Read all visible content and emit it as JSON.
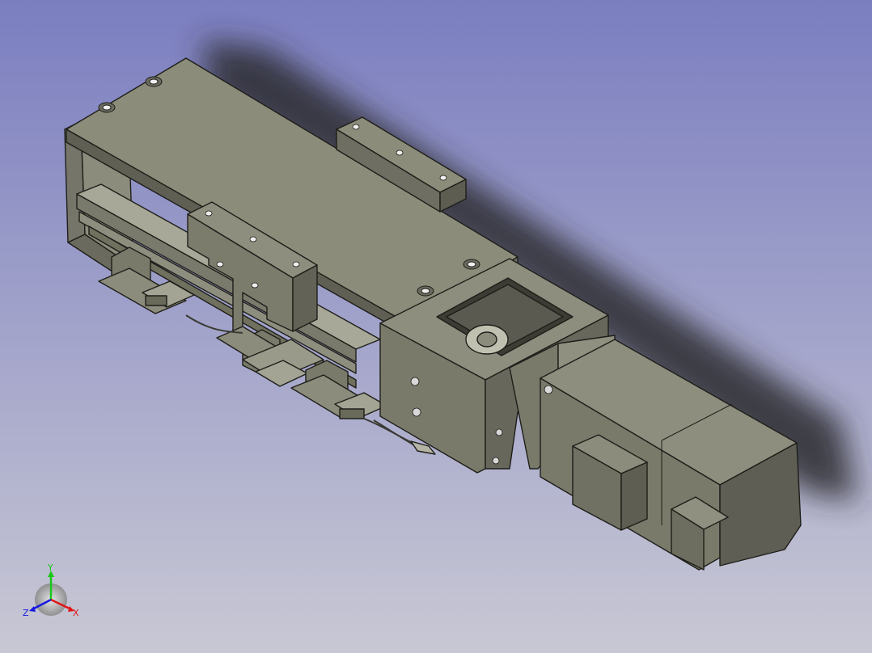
{
  "viewport": {
    "background_top": "#7b7ec0",
    "background_bottom": "#c8c8d4"
  },
  "model": {
    "body_color": "#8a8a78",
    "shadow_color": "#5c5c52",
    "light_color": "#a6a694",
    "edge_color": "#1e1e1a"
  },
  "axis_triad": {
    "x_label": "X",
    "y_label": "Y",
    "z_label": "Z",
    "x_color": "#e01818",
    "y_color": "#18c818",
    "z_color": "#1818e0"
  }
}
